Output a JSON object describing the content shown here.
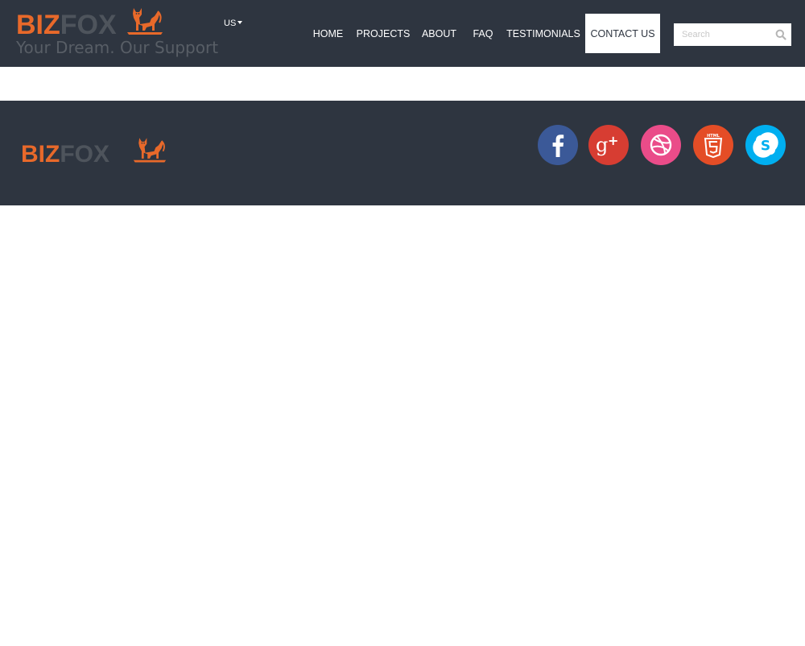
{
  "header": {
    "logo": {
      "biz": "BIZ",
      "fox": "FOX",
      "tagline": "Your Dream. Our Support"
    },
    "language": {
      "label": "US"
    },
    "nav": [
      {
        "label": "HOME",
        "active": false
      },
      {
        "label": "PROJECTS",
        "active": false
      },
      {
        "label": "ABOUT",
        "active": false
      },
      {
        "label": "FAQ",
        "active": false
      },
      {
        "label": "TESTIMONIALS",
        "active": false
      },
      {
        "label": "CONTACT US",
        "active": true
      }
    ],
    "search": {
      "placeholder": "Search",
      "value": ""
    }
  },
  "footer": {
    "logo": {
      "biz": "BIZ",
      "fox": "FOX"
    },
    "social": [
      {
        "name": "facebook-icon",
        "glyph": "f",
        "color": "#3b5998"
      },
      {
        "name": "google-plus-icon",
        "glyph": "g+",
        "color": "#d73d32"
      },
      {
        "name": "dribbble-icon",
        "glyph": "",
        "color": "#ea4c89"
      },
      {
        "name": "html5-icon",
        "glyph": "5",
        "color": "#e44d26"
      },
      {
        "name": "skype-icon",
        "glyph": "S",
        "color": "#00aff0"
      }
    ]
  },
  "colors": {
    "header_bg": "#2e3540",
    "brand_orange": "#e8692a",
    "logo_gray": "#4e545c",
    "page_bg": "#ffffff"
  }
}
